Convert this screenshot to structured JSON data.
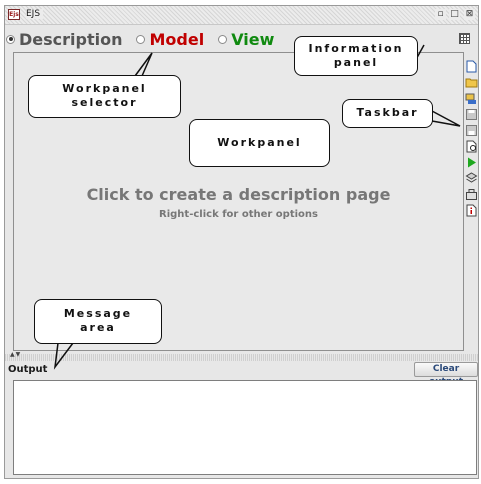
{
  "window": {
    "logo_text": "Ejs",
    "title": "EJS",
    "controls": [
      "restore-icon",
      "maximize-icon",
      "close-icon"
    ]
  },
  "selector": {
    "options": [
      {
        "label": "Description",
        "selected": true,
        "color": "#555555"
      },
      {
        "label": "Model",
        "selected": false,
        "color": "#c00000"
      },
      {
        "label": "View",
        "selected": false,
        "color": "#108a10"
      }
    ]
  },
  "workpanel": {
    "main_text": "Click to create a description page",
    "sub_text": "Right-click for other options"
  },
  "taskbar": {
    "icons": [
      "new-file-icon",
      "open-folder-icon",
      "search-icon",
      "save-icon",
      "save-as-icon",
      "preview-icon",
      "run-icon",
      "layers-icon",
      "options-icon",
      "info-icon"
    ]
  },
  "output": {
    "label": "Output",
    "clear_button": "Clear output",
    "content": ""
  },
  "callouts": {
    "information_panel": [
      "Information",
      "panel"
    ],
    "workpanel_selector": [
      "Workpanel",
      "selector"
    ],
    "taskbar": "Taskbar",
    "workpanel": "Workpanel",
    "message_area": [
      "Message",
      "area"
    ]
  }
}
